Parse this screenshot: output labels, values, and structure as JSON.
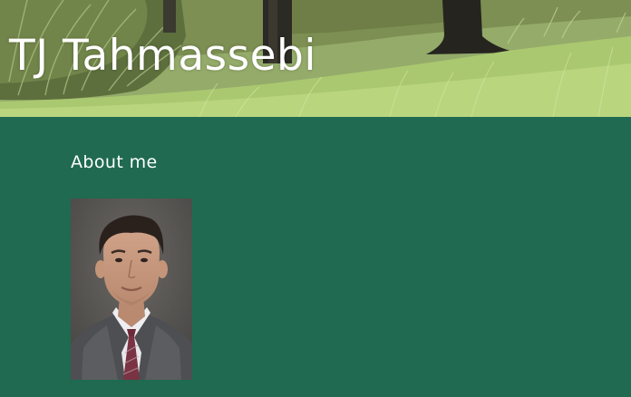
{
  "header": {
    "title": "TJ Tahmassebi",
    "banner_image": "grass-and-trees-photo"
  },
  "main": {
    "section_heading": "About me",
    "portrait_image": "headshot-photo"
  },
  "colors": {
    "background": "#1f6a50",
    "text": "#ffffff"
  }
}
